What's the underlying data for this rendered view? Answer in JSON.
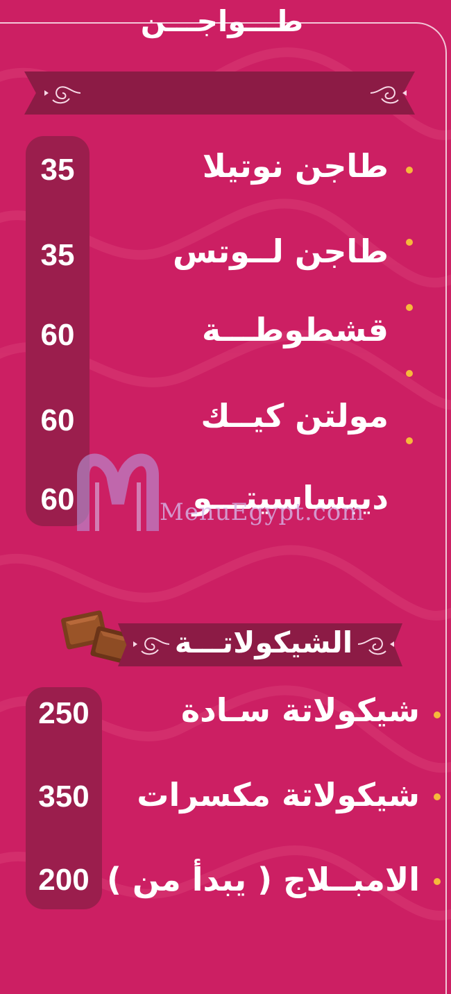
{
  "colors": {
    "background": "#cc1f63",
    "banner": "#8c1b45",
    "price_column": "#9b1e4d",
    "bullet": "#f6b93b",
    "text": "#ffffff"
  },
  "sections": [
    {
      "title": "طـــواجـــن",
      "items": [
        {
          "name": "طاجن نوتيلا",
          "price": "35"
        },
        {
          "name": "طاجن لــوتس",
          "price": "35"
        },
        {
          "name": "قشطوطـــة",
          "price": "60"
        },
        {
          "name": "مولتن كيــك",
          "price": "60"
        },
        {
          "name": "ديبساسيتـــو",
          "price": "60"
        }
      ]
    },
    {
      "title": "الشيكولاتـــة",
      "items": [
        {
          "name": "شيكولاتة سـادة",
          "price": "250"
        },
        {
          "name": "شيكولاتة مكسرات",
          "price": "350"
        },
        {
          "name": "الامبــلاج ( يبدأ من )",
          "price": "200"
        }
      ]
    }
  ],
  "watermark": {
    "text": "MenuEgypt.com"
  },
  "icons": [
    "flourish-left-icon",
    "flourish-right-icon",
    "chocolate-icon",
    "bullet-icon"
  ]
}
